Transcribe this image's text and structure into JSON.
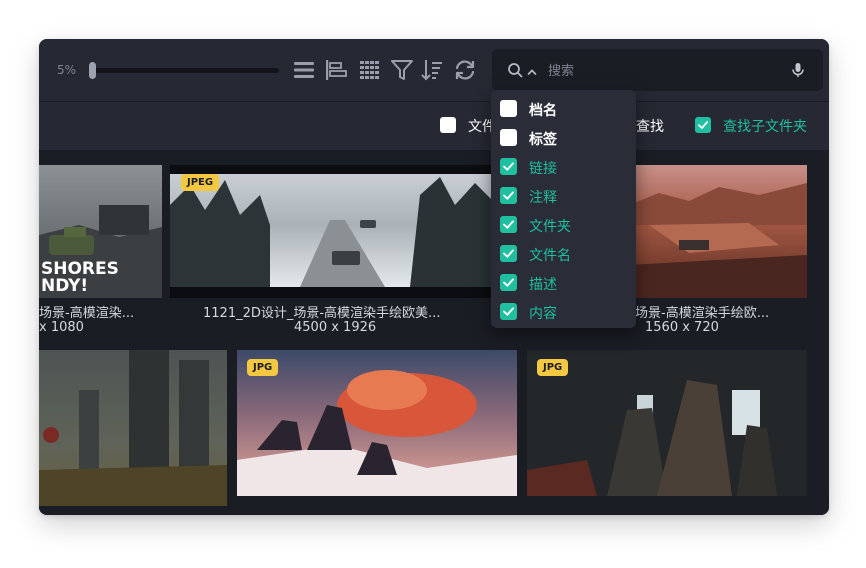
{
  "toolbar": {
    "zoom_label": "5%",
    "zoom_value_percent": 5,
    "icons": [
      "list-view-icon",
      "align-left-icon",
      "grid-view-icon",
      "filter-icon",
      "sort-icon",
      "refresh-icon"
    ]
  },
  "search": {
    "placeholder": "搜索",
    "value": "",
    "icons": [
      "search-icon",
      "chevron-up-icon",
      "microphone-icon"
    ]
  },
  "filterbar": {
    "items": [
      {
        "label": "文件",
        "checked": false
      },
      {
        "label": "查找",
        "checked": null
      },
      {
        "label": "查找子文件夹",
        "checked": true
      }
    ]
  },
  "dropdown": {
    "items": [
      {
        "label": "档名",
        "checked": false
      },
      {
        "label": "标签",
        "checked": false
      },
      {
        "label": "链接",
        "checked": true
      },
      {
        "label": "注释",
        "checked": true
      },
      {
        "label": "文件夹",
        "checked": true
      },
      {
        "label": "文件名",
        "checked": true
      },
      {
        "label": "描述",
        "checked": true
      },
      {
        "label": "内容",
        "checked": true
      }
    ]
  },
  "gallery": {
    "items": [
      {
        "badge": "",
        "name": "场景-高模渲染...",
        "size": "x 1080",
        "overlay_text": "SHORES\nNDY!"
      },
      {
        "badge": "JPEG",
        "name": "1121_2D设计_场景-高模渲染手绘欧美...",
        "size": "4500 x 1926"
      },
      {
        "badge": "",
        "name": "场景-高模渲染手绘欧...",
        "size": "1560 x 720"
      },
      {
        "badge": "",
        "name": "",
        "size": ""
      },
      {
        "badge": "JPG",
        "name": "",
        "size": ""
      },
      {
        "badge": "JPG",
        "name": "",
        "size": ""
      }
    ]
  },
  "colors": {
    "accent": "#1fbf9f",
    "badge": "#f5c842",
    "background": "#1b1d25",
    "toolbar": "#262833"
  }
}
